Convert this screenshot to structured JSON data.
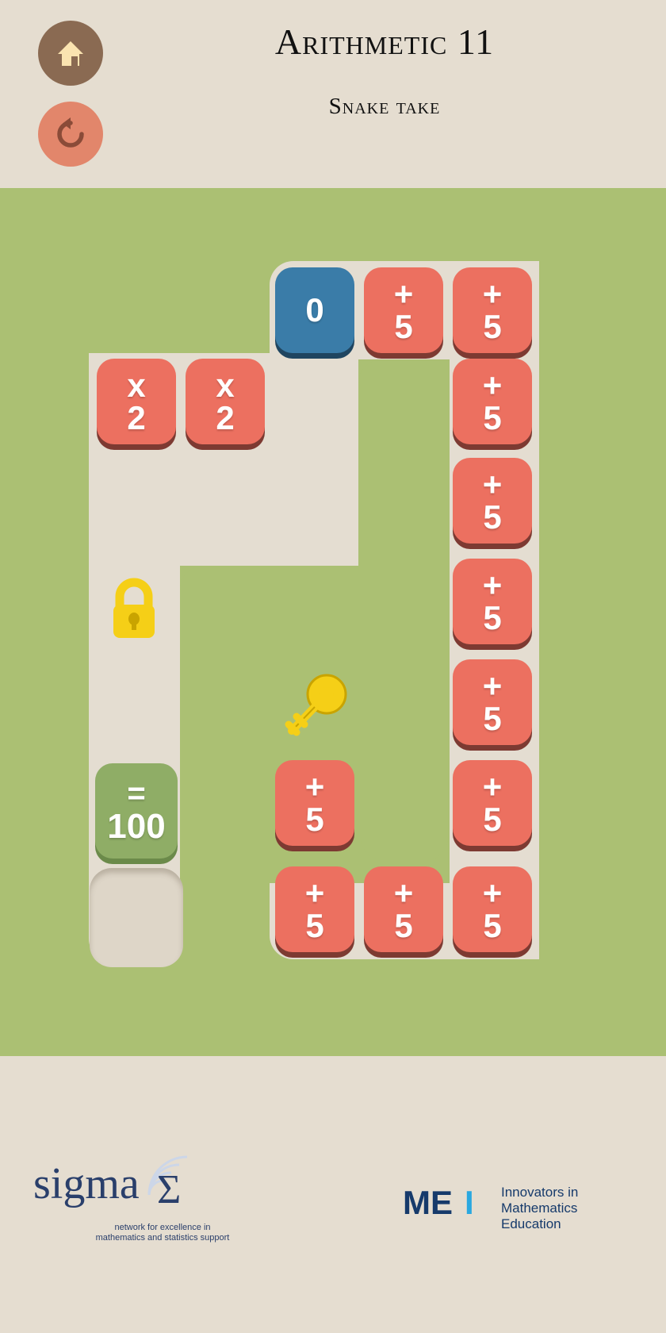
{
  "header": {
    "title": "Arithmetic 11",
    "subtitle": "Snake take",
    "home_icon": "home-icon",
    "undo_icon": "restart-icon",
    "home_color": "#8a6a52",
    "undo_color": "#e2866b"
  },
  "board": {
    "background_color": "#abc073",
    "track_color": "#e4ddd1",
    "op_tile_color": "#ec7060",
    "start_tile_color": "#3a7ca8",
    "goal_tile_color": "#8fad66",
    "start": {
      "value": "0"
    },
    "goal": {
      "op": "=",
      "value": "100"
    },
    "lock_icon": "lock-icon",
    "key_icon": "key-icon",
    "tiles": [
      {
        "id": "t-r0c3",
        "op": "",
        "value": "0",
        "kind": "start",
        "col": 3,
        "row": 0
      },
      {
        "id": "t-r0c4",
        "op": "+",
        "value": "5",
        "kind": "op",
        "col": 4,
        "row": 0
      },
      {
        "id": "t-r0c5",
        "op": "+",
        "value": "5",
        "kind": "op",
        "col": 5,
        "row": 0
      },
      {
        "id": "t-r1c1",
        "op": "x",
        "value": "2",
        "kind": "op",
        "col": 1,
        "row": 1
      },
      {
        "id": "t-r1c2",
        "op": "x",
        "value": "2",
        "kind": "op",
        "col": 2,
        "row": 1
      },
      {
        "id": "t-r1c5",
        "op": "+",
        "value": "5",
        "kind": "op",
        "col": 5,
        "row": 1
      },
      {
        "id": "t-r2c5",
        "op": "+",
        "value": "5",
        "kind": "op",
        "col": 5,
        "row": 2
      },
      {
        "id": "t-r3c5",
        "op": "+",
        "value": "5",
        "kind": "op",
        "col": 5,
        "row": 3
      },
      {
        "id": "t-r4c5",
        "op": "+",
        "value": "5",
        "kind": "op",
        "col": 5,
        "row": 4
      },
      {
        "id": "t-r5c5",
        "op": "+",
        "value": "5",
        "kind": "op",
        "col": 5,
        "row": 5
      },
      {
        "id": "t-r5c3",
        "op": "+",
        "value": "5",
        "kind": "op",
        "col": 3,
        "row": 5
      },
      {
        "id": "t-r6c3",
        "op": "+",
        "value": "5",
        "kind": "op",
        "col": 3,
        "row": 6
      },
      {
        "id": "t-r6c4",
        "op": "+",
        "value": "5",
        "kind": "op",
        "col": 4,
        "row": 6
      },
      {
        "id": "t-r6c5",
        "op": "+",
        "value": "5",
        "kind": "op",
        "col": 5,
        "row": 6
      }
    ],
    "goal_tile": {
      "id": "t-goal",
      "op": "=",
      "value": "100"
    },
    "empty_slot": {
      "id": "slot-empty",
      "label": ""
    }
  },
  "footer": {
    "sigma_name": "sigma",
    "sigma_caption": "network for excellence in\nmathematics and statistics support",
    "mei_name": "MEI",
    "mei_caption_line1": "Innovators in",
    "mei_caption_line2": "Mathematics",
    "mei_caption_line3": "Education",
    "sigma_color": "#2a3f6b",
    "mei_dark": "#163a6b",
    "mei_light": "#2aa8e0"
  }
}
